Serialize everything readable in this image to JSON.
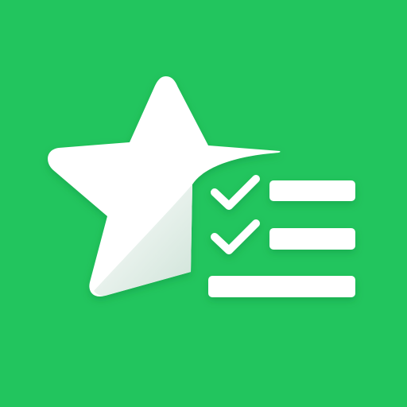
{
  "icon": {
    "name": "star-checklist-icon",
    "background_color": "#22C55E",
    "foreground_color": "#FFFFFF",
    "fold_shadow_color": "#DDEBE3",
    "checklist": {
      "checked_items": 2,
      "total_items": 3
    }
  }
}
